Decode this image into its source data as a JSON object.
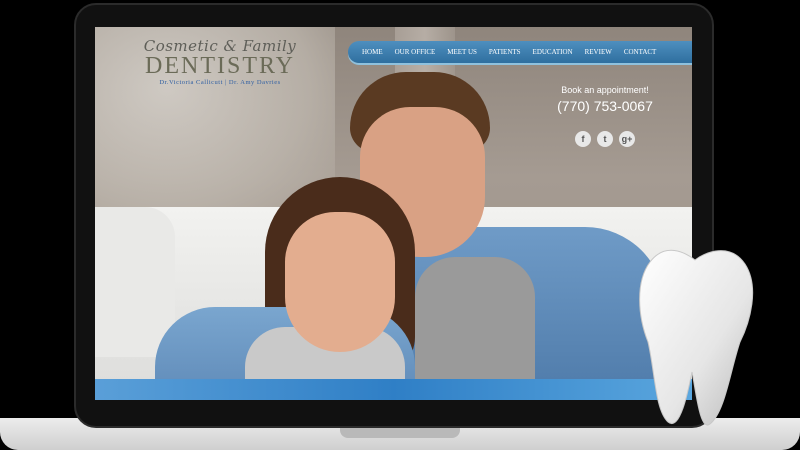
{
  "logo": {
    "script": "Cosmetic & Family",
    "main": "DENTISTRY",
    "doctors": "Dr.Victoria Callicutt | Dr. Amy Davries"
  },
  "nav": {
    "items": [
      "HOME",
      "OUR OFFICE",
      "MEET US",
      "PATIENTS",
      "EDUCATION",
      "REVIEW",
      "CONTACT"
    ]
  },
  "contact": {
    "appointment": "Book an appointment!",
    "phone": "(770) 753-0067"
  },
  "social": {
    "facebook": "f",
    "twitter": "t",
    "google": "g+"
  },
  "icons": [
    "facebook-icon",
    "twitter-icon",
    "google-plus-icon",
    "tooth-icon"
  ],
  "colors": {
    "nav": "#3a7fb0",
    "band": "#2f7fc6",
    "logo_sub": "#2f5fa3"
  }
}
